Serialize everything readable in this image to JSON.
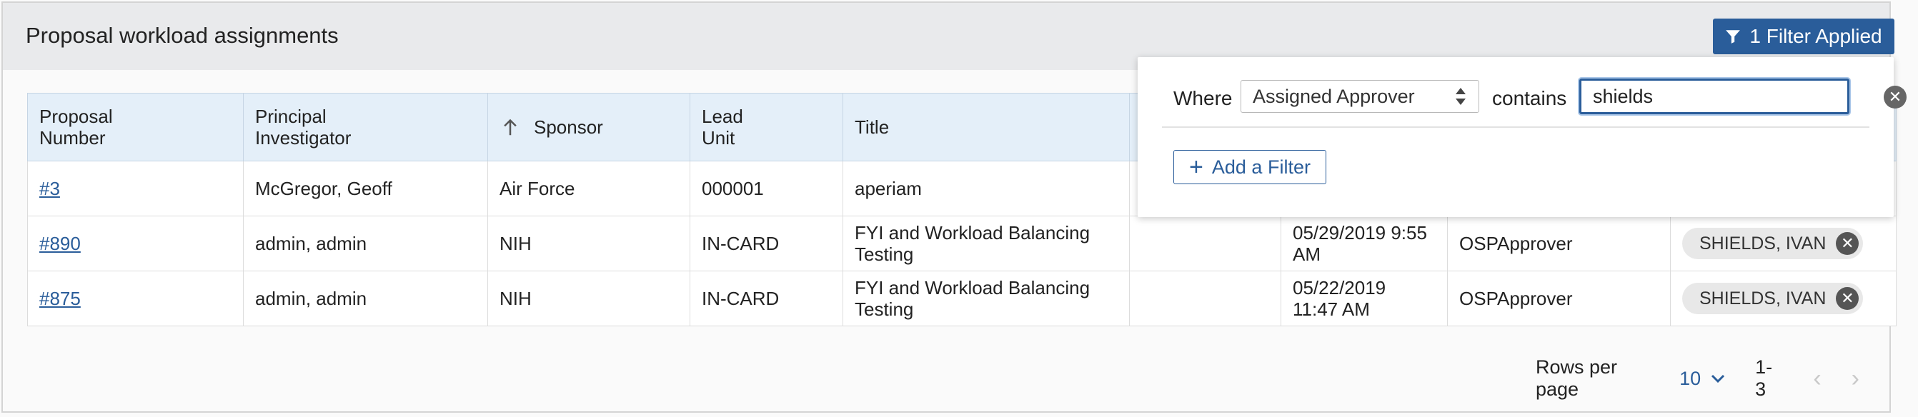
{
  "header": {
    "title": "Proposal workload assignments",
    "filter_button_label": "1 Filter Applied"
  },
  "table": {
    "columns": [
      "Proposal Number",
      "Principal Investigator",
      "Sponsor",
      "Lead Unit",
      "Title",
      "",
      "",
      "",
      ""
    ],
    "sort": {
      "column": "Sponsor",
      "direction": "ascending"
    },
    "rows": [
      {
        "number": "#3",
        "pi": "McGregor, Geoff",
        "sponsor": "Air Force",
        "lead_unit": "000001",
        "title": "aperiam",
        "col6": "",
        "date": "",
        "role": "",
        "approver": ""
      },
      {
        "number": "#890",
        "pi": "admin, admin",
        "sponsor": "NIH",
        "lead_unit": "IN-CARD",
        "title": "FYI and Workload Balancing Testing",
        "col6": "",
        "date": "05/29/2019 9:55 AM",
        "role": "OSPApprover",
        "approver": "SHIELDS, IVAN"
      },
      {
        "number": "#875",
        "pi": "admin, admin",
        "sponsor": "NIH",
        "lead_unit": "IN-CARD",
        "title": "FYI and Workload Balancing Testing",
        "col6": "",
        "date": "05/22/2019 11:47 AM",
        "role": "OSPApprover",
        "approver": "SHIELDS, IVAN"
      }
    ]
  },
  "pagination": {
    "rows_per_page_label": "Rows per page",
    "rows_per_page_value": "10",
    "range": "1-3"
  },
  "filter_popover": {
    "where_label": "Where",
    "field_selected": "Assigned Approver",
    "operator_label": "contains",
    "value": "shields",
    "add_filter_label": "Add a Filter"
  },
  "colors": {
    "accent": "#2a5d9a",
    "header_bg": "#e9eaec",
    "table_header_bg": "#e4eff9"
  }
}
